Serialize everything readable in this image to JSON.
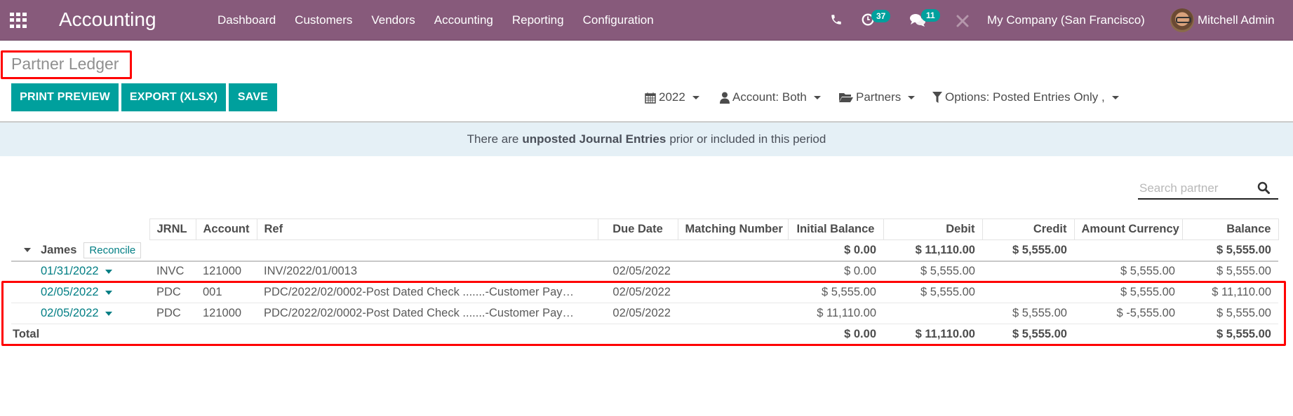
{
  "navbar": {
    "app_title": "Accounting",
    "menu": [
      "Dashboard",
      "Customers",
      "Vendors",
      "Accounting",
      "Reporting",
      "Configuration"
    ],
    "activity_count": "37",
    "message_count": "11",
    "company": "My Company (San Francisco)",
    "user": "Mitchell Admin",
    "icons": [
      "apps-icon",
      "phone-icon",
      "activity-clock-icon",
      "chat-icon",
      "debug-tools-icon",
      "avatar"
    ]
  },
  "control_panel": {
    "title": "Partner Ledger",
    "buttons": {
      "print_preview": "PRINT PREVIEW",
      "export": "EXPORT (XLSX)",
      "save": "SAVE"
    },
    "filters": {
      "date": "2022",
      "account": "Account: Both",
      "partners": "Partners",
      "options": "Options: Posted Entries Only ,"
    }
  },
  "alert": {
    "prefix": "There are",
    "bold": "unposted Journal Entries",
    "suffix": "prior or included in this period"
  },
  "search": {
    "placeholder": "Search partner",
    "value": ""
  },
  "table": {
    "columns": [
      "",
      "JRNL",
      "Account",
      "Ref",
      "Due Date",
      "Matching Number",
      "Initial Balance",
      "Debit",
      "Credit",
      "Amount Currency",
      "Balance"
    ],
    "partner": {
      "name": "James",
      "reconcile_label": "Reconcile",
      "initial_balance": "$ 0.00",
      "debit": "$ 11,110.00",
      "credit": "$ 5,555.00",
      "amount_currency": "",
      "balance": "$ 5,555.00"
    },
    "lines": [
      {
        "date": "01/31/2022",
        "jrnl": "INVC",
        "account": "121000",
        "ref": "INV/2022/01/0013",
        "due_date": "02/05/2022",
        "matching": "",
        "initial_balance": "$ 0.00",
        "debit": "$ 5,555.00",
        "credit": "",
        "amount_currency": "$ 5,555.00",
        "balance": "$ 5,555.00"
      },
      {
        "date": "02/05/2022",
        "jrnl": "PDC",
        "account": "001",
        "ref": "PDC/2022/02/0002-Post Dated Check .......-Customer Pay…",
        "due_date": "02/05/2022",
        "matching": "",
        "initial_balance": "$ 5,555.00",
        "debit": "$ 5,555.00",
        "credit": "",
        "amount_currency": "$ 5,555.00",
        "balance": "$ 11,110.00"
      },
      {
        "date": "02/05/2022",
        "jrnl": "PDC",
        "account": "121000",
        "ref": "PDC/2022/02/0002-Post Dated Check .......-Customer Pay…",
        "due_date": "02/05/2022",
        "matching": "",
        "initial_balance": "$ 11,110.00",
        "debit": "",
        "credit": "$ 5,555.00",
        "amount_currency": "$ -5,555.00",
        "balance": "$ 5,555.00"
      }
    ],
    "total": {
      "label": "Total",
      "initial_balance": "$ 0.00",
      "debit": "$ 11,110.00",
      "credit": "$ 5,555.00",
      "amount_currency": "",
      "balance": "$ 5,555.00"
    }
  },
  "colors": {
    "navbar": "#875a7b",
    "primary_button": "#00a09d",
    "link": "#017e84",
    "alert_bg": "#e5f0f6",
    "annotation_red": "#ff0000"
  }
}
